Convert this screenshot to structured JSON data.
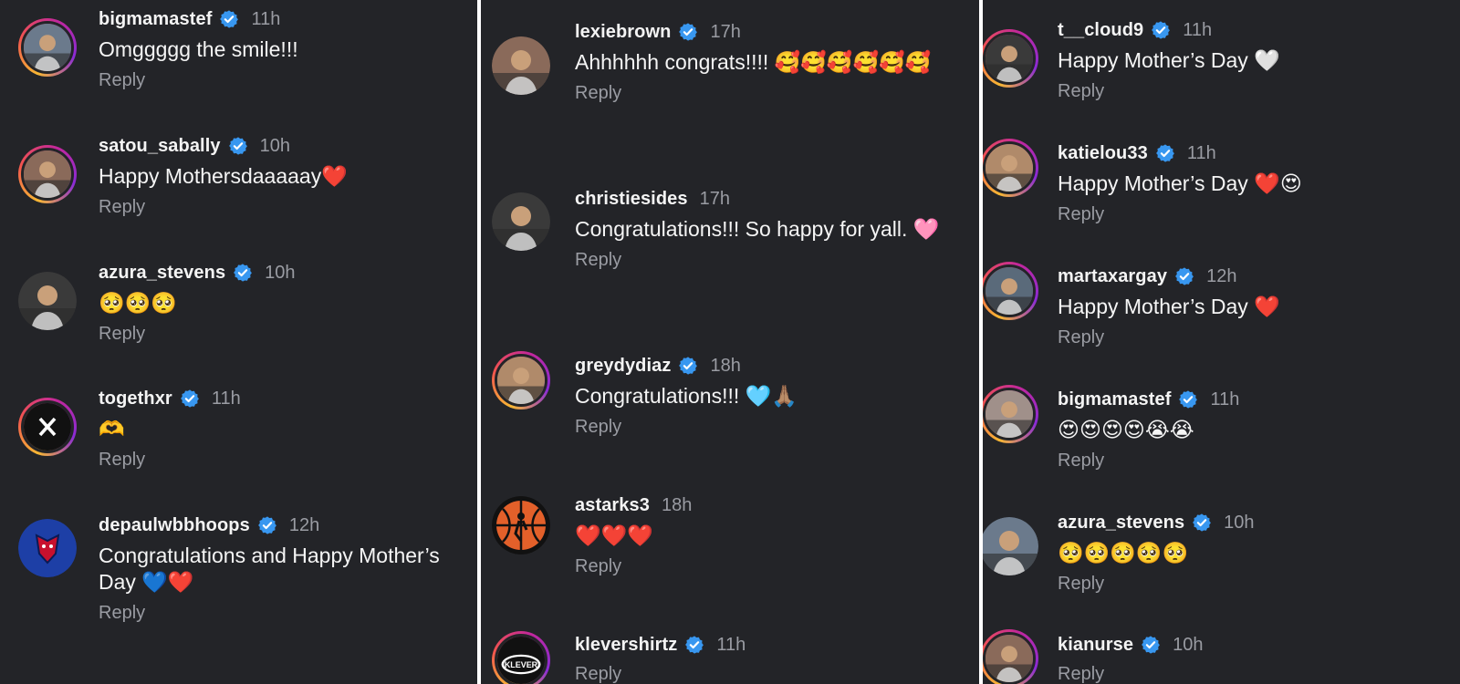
{
  "reply_label": "Reply",
  "colors": {
    "background": "#232428",
    "divider": "#ffffff",
    "verified": "#3897f0",
    "muted": "#9a9ca3"
  },
  "columns": [
    {
      "comments": [
        {
          "username": "bigmamastef",
          "verified": true,
          "time": "11h",
          "text": "Omggggg the smile!!!",
          "avatar_icon": "user-photo-icon",
          "story_ring": true
        },
        {
          "username": "satou_sabally",
          "verified": true,
          "time": "10h",
          "text": "Happy Mothersdaaaaay❤️",
          "avatar_icon": "user-photo-icon",
          "story_ring": true
        },
        {
          "username": "azura_stevens",
          "verified": true,
          "time": "10h",
          "text": "🥺🥺🥺",
          "avatar_icon": "user-photo-icon",
          "story_ring": false
        },
        {
          "username": "togethxr",
          "verified": true,
          "time": "11h",
          "text": "🫶",
          "avatar_icon": "togethxr-logo-icon",
          "story_ring": true
        },
        {
          "username": "depaulwbbhoops",
          "verified": true,
          "time": "12h",
          "text": "Congratulations and Happy Mother’s Day 💙❤️",
          "avatar_icon": "depaul-logo-icon",
          "story_ring": false
        }
      ]
    },
    {
      "comments": [
        {
          "username": "lexiebrown",
          "verified": true,
          "time": "17h",
          "text": "Ahhhhhh congrats!!!! 🥰🥰🥰🥰🥰🥰",
          "avatar_icon": "user-photo-icon",
          "story_ring": false
        },
        {
          "username": "christiesides",
          "verified": false,
          "time": "17h",
          "text": "Congratulations!!! So happy for yall. 🩷",
          "avatar_icon": "user-photo-icon",
          "story_ring": false
        },
        {
          "username": "greydydiaz",
          "verified": true,
          "time": "18h",
          "text": "Congratulations!!! 🩵🙏🏽",
          "avatar_icon": "user-photo-icon",
          "story_ring": true
        },
        {
          "username": "astarks3",
          "verified": false,
          "time": "18h",
          "text": "❤️❤️❤️",
          "avatar_icon": "starks-training-logo-icon",
          "story_ring": false
        },
        {
          "username": "klevershirtz",
          "verified": true,
          "time": "11h",
          "text": "",
          "avatar_icon": "klever-logo-icon",
          "story_ring": true
        }
      ]
    },
    {
      "comments": [
        {
          "username": "t__cloud9",
          "verified": true,
          "time": "11h",
          "text": "Happy Mother’s Day 🤍",
          "avatar_icon": "user-photo-icon",
          "story_ring": true
        },
        {
          "username": "katielou33",
          "verified": true,
          "time": "11h",
          "text": "Happy Mother’s Day ❤️😍",
          "avatar_icon": "user-photo-icon",
          "story_ring": true
        },
        {
          "username": "martaxargay",
          "verified": true,
          "time": "12h",
          "text": "Happy Mother’s Day ❤️",
          "avatar_icon": "user-photo-icon",
          "story_ring": true
        },
        {
          "username": "bigmamastef",
          "verified": true,
          "time": "11h",
          "text": "😍😍😍😍😭😭",
          "avatar_icon": "user-photo-icon",
          "story_ring": true
        },
        {
          "username": "azura_stevens",
          "verified": true,
          "time": "10h",
          "text": "🥺🥺🥺🥺🥺",
          "avatar_icon": "user-photo-icon",
          "story_ring": false
        },
        {
          "username": "kianurse",
          "verified": true,
          "time": "10h",
          "text": "",
          "avatar_icon": "user-photo-icon",
          "story_ring": true
        }
      ]
    }
  ]
}
